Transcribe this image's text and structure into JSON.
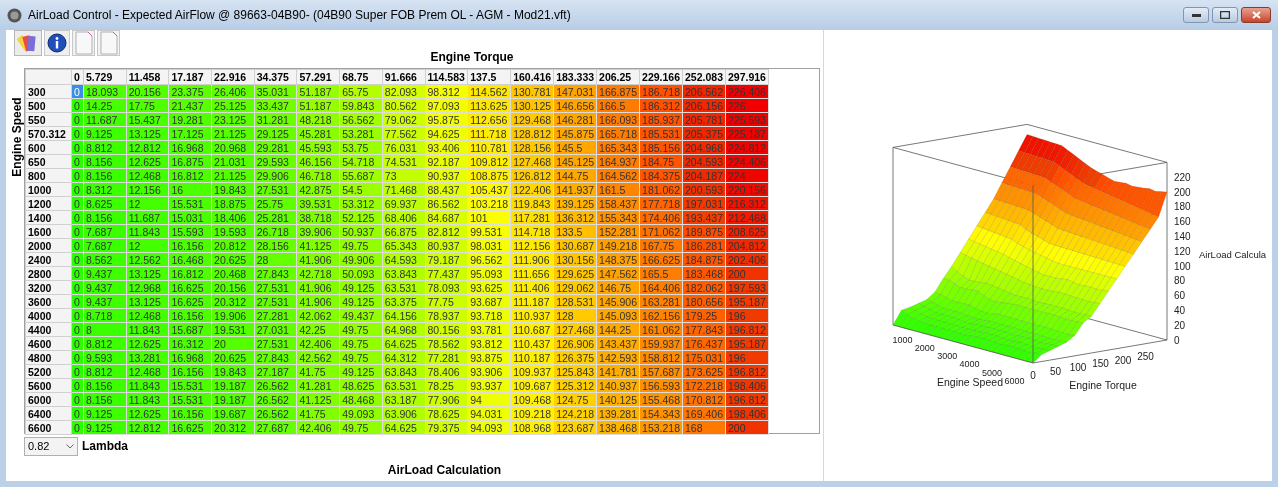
{
  "window": {
    "title": "AirLoad Control - Expected AirFlow @ 89663-04B90- (04B90 Super FOB Prem OL - AGM - Mod21.vft)"
  },
  "toolbar": [
    {
      "kind": "palette"
    },
    {
      "kind": "info"
    },
    {
      "kind": "page"
    },
    {
      "kind": "page"
    }
  ],
  "table": {
    "title": "Engine Torque",
    "row_axis": "Engine Speed",
    "columns": [
      "0",
      "5.729",
      "11.458",
      "17.187",
      "22.916",
      "34.375",
      "57.291",
      "68.75",
      "91.666",
      "114.583",
      "137.5",
      "160.416",
      "183.333",
      "206.25",
      "229.166",
      "252.083",
      "297.916"
    ],
    "rows": [
      {
        "speed": "300",
        "selected": true,
        "values": [
          "0",
          "18.093",
          "20.156",
          "23.375",
          "26.406",
          "35.031",
          "51.187",
          "65.75",
          "82.093",
          "98.312",
          "114.562",
          "130.781",
          "147.031",
          "166.875",
          "186.718",
          "206.562",
          "226.406"
        ]
      },
      {
        "speed": "500",
        "selected": false,
        "values": [
          "0",
          "14.25",
          "17.75",
          "21.437",
          "25.125",
          "33.437",
          "51.187",
          "59.843",
          "80.562",
          "97.093",
          "113.625",
          "130.125",
          "146.656",
          "166.5",
          "186.312",
          "206.156",
          "226"
        ]
      },
      {
        "speed": "550",
        "selected": false,
        "values": [
          "0",
          "11.687",
          "15.437",
          "19.281",
          "23.125",
          "31.281",
          "48.218",
          "56.562",
          "79.062",
          "95.875",
          "112.656",
          "129.468",
          "146.281",
          "166.093",
          "185.937",
          "205.781",
          "225.593"
        ]
      },
      {
        "speed": "570.312",
        "selected": false,
        "values": [
          "0",
          "9.125",
          "13.125",
          "17.125",
          "21.125",
          "29.125",
          "45.281",
          "53.281",
          "77.562",
          "94.625",
          "111.718",
          "128.812",
          "145.875",
          "165.718",
          "185.531",
          "205.375",
          "225.187"
        ]
      },
      {
        "speed": "600",
        "selected": false,
        "values": [
          "0",
          "8.812",
          "12.812",
          "16.968",
          "20.968",
          "29.281",
          "45.593",
          "53.75",
          "76.031",
          "93.406",
          "110.781",
          "128.156",
          "145.5",
          "165.343",
          "185.156",
          "204.968",
          "224.812"
        ]
      },
      {
        "speed": "650",
        "selected": false,
        "values": [
          "0",
          "8.156",
          "12.625",
          "16.875",
          "21.031",
          "29.593",
          "46.156",
          "54.718",
          "74.531",
          "92.187",
          "109.812",
          "127.468",
          "145.125",
          "164.937",
          "184.75",
          "204.593",
          "224.406"
        ]
      },
      {
        "speed": "800",
        "selected": false,
        "values": [
          "0",
          "8.156",
          "12.468",
          "16.812",
          "21.125",
          "29.906",
          "46.718",
          "55.687",
          "73",
          "90.937",
          "108.875",
          "126.812",
          "144.75",
          "164.562",
          "184.375",
          "204.187",
          "224"
        ]
      },
      {
        "speed": "1000",
        "selected": false,
        "values": [
          "0",
          "8.312",
          "12.156",
          "16",
          "19.843",
          "27.531",
          "42.875",
          "54.5",
          "71.468",
          "88.437",
          "105.437",
          "122.406",
          "141.937",
          "161.5",
          "181.062",
          "200.593",
          "220.156"
        ]
      },
      {
        "speed": "1200",
        "selected": false,
        "values": [
          "0",
          "8.625",
          "12",
          "15.531",
          "18.875",
          "25.75",
          "39.531",
          "53.312",
          "69.937",
          "86.562",
          "103.218",
          "119.843",
          "139.125",
          "158.437",
          "177.718",
          "197.031",
          "216.312"
        ]
      },
      {
        "speed": "1400",
        "selected": false,
        "values": [
          "0",
          "8.156",
          "11.687",
          "15.031",
          "18.406",
          "25.281",
          "38.718",
          "52.125",
          "68.406",
          "84.687",
          "101",
          "117.281",
          "136.312",
          "155.343",
          "174.406",
          "193.437",
          "212.468"
        ]
      },
      {
        "speed": "1600",
        "selected": false,
        "values": [
          "0",
          "7.687",
          "11.843",
          "15.593",
          "19.593",
          "26.718",
          "39.906",
          "50.937",
          "66.875",
          "82.812",
          "99.531",
          "114.718",
          "133.5",
          "152.281",
          "171.062",
          "189.875",
          "208.625"
        ]
      },
      {
        "speed": "2000",
        "selected": false,
        "values": [
          "0",
          "7.687",
          "12",
          "16.156",
          "20.812",
          "28.156",
          "41.125",
          "49.75",
          "65.343",
          "80.937",
          "98.031",
          "112.156",
          "130.687",
          "149.218",
          "167.75",
          "186.281",
          "204.812"
        ]
      },
      {
        "speed": "2400",
        "selected": false,
        "values": [
          "0",
          "8.562",
          "12.562",
          "16.468",
          "20.625",
          "28",
          "41.906",
          "49.906",
          "64.593",
          "79.187",
          "96.562",
          "111.906",
          "130.156",
          "148.375",
          "166.625",
          "184.875",
          "202.406"
        ]
      },
      {
        "speed": "2800",
        "selected": false,
        "values": [
          "0",
          "9.437",
          "13.125",
          "16.812",
          "20.468",
          "27.843",
          "42.718",
          "50.093",
          "63.843",
          "77.437",
          "95.093",
          "111.656",
          "129.625",
          "147.562",
          "165.5",
          "183.468",
          "200"
        ]
      },
      {
        "speed": "3200",
        "selected": false,
        "values": [
          "0",
          "9.437",
          "12.968",
          "16.625",
          "20.156",
          "27.531",
          "41.906",
          "49.125",
          "63.531",
          "78.093",
          "93.625",
          "111.406",
          "129.062",
          "146.75",
          "164.406",
          "182.062",
          "197.593"
        ]
      },
      {
        "speed": "3600",
        "selected": false,
        "values": [
          "0",
          "9.437",
          "13.125",
          "16.625",
          "20.312",
          "27.531",
          "41.906",
          "49.125",
          "63.375",
          "77.75",
          "93.687",
          "111.187",
          "128.531",
          "145.906",
          "163.281",
          "180.656",
          "195.187"
        ]
      },
      {
        "speed": "4000",
        "selected": false,
        "values": [
          "0",
          "8.718",
          "12.468",
          "16.156",
          "19.906",
          "27.281",
          "42.062",
          "49.437",
          "64.156",
          "78.937",
          "93.718",
          "110.937",
          "128",
          "145.093",
          "162.156",
          "179.25",
          "196"
        ]
      },
      {
        "speed": "4400",
        "selected": false,
        "values": [
          "0",
          "8",
          "11.843",
          "15.687",
          "19.531",
          "27.031",
          "42.25",
          "49.75",
          "64.968",
          "80.156",
          "93.781",
          "110.687",
          "127.468",
          "144.25",
          "161.062",
          "177.843",
          "196.812"
        ]
      },
      {
        "speed": "4600",
        "selected": false,
        "values": [
          "0",
          "8.812",
          "12.625",
          "16.312",
          "20",
          "27.531",
          "42.406",
          "49.75",
          "64.625",
          "78.562",
          "93.812",
          "110.437",
          "126.906",
          "143.437",
          "159.937",
          "176.437",
          "195.187"
        ]
      },
      {
        "speed": "4800",
        "selected": false,
        "values": [
          "0",
          "9.593",
          "13.281",
          "16.968",
          "20.625",
          "27.843",
          "42.562",
          "49.75",
          "64.312",
          "77.281",
          "93.875",
          "110.187",
          "126.375",
          "142.593",
          "158.812",
          "175.031",
          "196"
        ]
      },
      {
        "speed": "5200",
        "selected": false,
        "values": [
          "0",
          "8.812",
          "12.468",
          "16.156",
          "19.843",
          "27.187",
          "41.75",
          "49.125",
          "63.843",
          "78.406",
          "93.906",
          "109.937",
          "125.843",
          "141.781",
          "157.687",
          "173.625",
          "196.812"
        ]
      },
      {
        "speed": "5600",
        "selected": false,
        "values": [
          "0",
          "8.156",
          "11.843",
          "15.531",
          "19.187",
          "26.562",
          "41.281",
          "48.625",
          "63.531",
          "78.25",
          "93.937",
          "109.687",
          "125.312",
          "140.937",
          "156.593",
          "172.218",
          "198.406"
        ]
      },
      {
        "speed": "6000",
        "selected": false,
        "values": [
          "0",
          "8.156",
          "11.843",
          "15.531",
          "19.187",
          "26.562",
          "41.125",
          "48.468",
          "63.187",
          "77.906",
          "94",
          "109.468",
          "124.75",
          "140.125",
          "155.468",
          "170.812",
          "196.812"
        ]
      },
      {
        "speed": "6400",
        "selected": false,
        "values": [
          "0",
          "9.125",
          "12.625",
          "16.156",
          "19.687",
          "26.562",
          "41.75",
          "49.093",
          "63.906",
          "78.625",
          "94.031",
          "109.218",
          "124.218",
          "139.281",
          "154.343",
          "169.406",
          "198.406"
        ]
      },
      {
        "speed": "6600",
        "selected": false,
        "values": [
          "0",
          "9.125",
          "12.812",
          "16.625",
          "20.312",
          "27.687",
          "42.406",
          "49.75",
          "64.625",
          "79.375",
          "94.093",
          "108.968",
          "123.687",
          "138.468",
          "153.218",
          "168",
          "200"
        ]
      }
    ]
  },
  "lambda": {
    "value": "0.82",
    "label": "Lambda"
  },
  "footer_title": "AirLoad Calculation",
  "plot": {
    "z_label": "AirLoad Calcula",
    "speed_label": "Engine Speed",
    "torque_label": "Engine Torque",
    "z_ticks": [
      "220",
      "200",
      "180",
      "160",
      "140",
      "120",
      "100",
      "80",
      "60",
      "40",
      "20",
      "0"
    ],
    "speed_ticks": [
      "1000",
      "2000",
      "3000",
      "4000",
      "5000",
      "6000"
    ],
    "torque_ticks": [
      "0",
      "50",
      "100",
      "150",
      "200",
      "250"
    ]
  }
}
